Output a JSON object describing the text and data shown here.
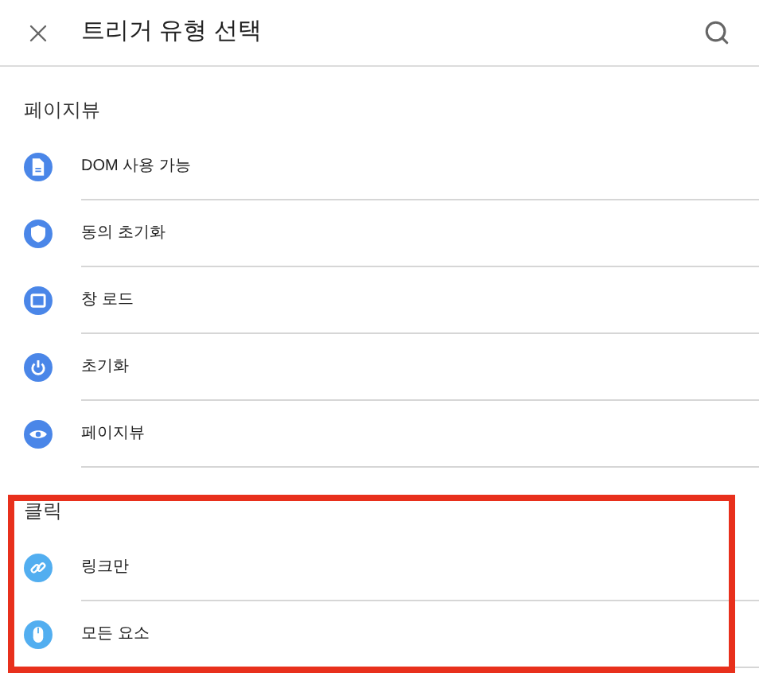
{
  "header": {
    "title": "트리거 유형 선택"
  },
  "sections": [
    {
      "title": "페이지뷰",
      "kind": "pageview",
      "highlighted": false,
      "items": [
        {
          "label": "DOM 사용 가능",
          "kind": "document"
        },
        {
          "label": "동의 초기화",
          "kind": "shield"
        },
        {
          "label": "창 로드",
          "kind": "window"
        },
        {
          "label": "초기화",
          "kind": "power"
        },
        {
          "label": "페이지뷰",
          "kind": "eye"
        }
      ]
    },
    {
      "title": "클릭",
      "kind": "click",
      "highlighted": true,
      "items": [
        {
          "label": "링크만",
          "kind": "link"
        },
        {
          "label": "모든 요소",
          "kind": "mouse"
        }
      ]
    }
  ]
}
